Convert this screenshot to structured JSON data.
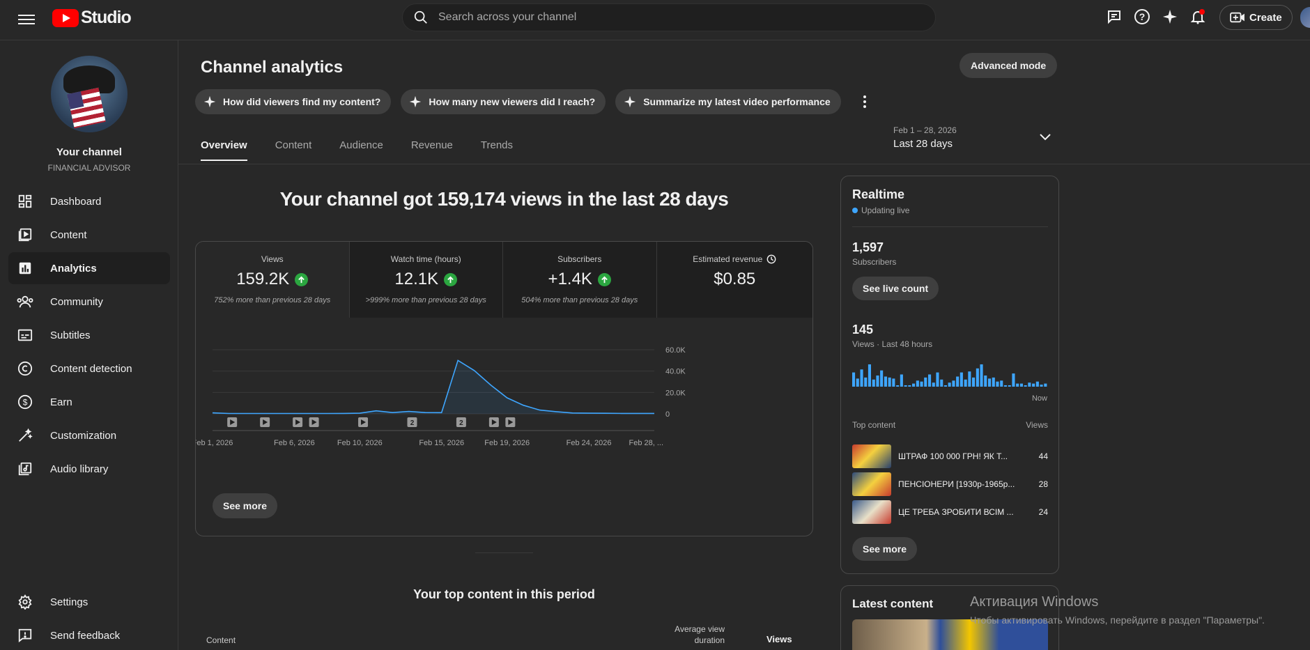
{
  "header": {
    "logo_text": "Studio",
    "search_placeholder": "Search across your channel",
    "create_label": "Create"
  },
  "sidebar": {
    "channel_name": "Your channel",
    "channel_subtitle": "FINANCIAL ADVISOR",
    "items": [
      {
        "label": "Dashboard",
        "icon": "dashboard-icon"
      },
      {
        "label": "Content",
        "icon": "content-icon"
      },
      {
        "label": "Analytics",
        "icon": "analytics-icon",
        "active": true
      },
      {
        "label": "Community",
        "icon": "community-icon"
      },
      {
        "label": "Subtitles",
        "icon": "subtitles-icon"
      },
      {
        "label": "Content detection",
        "icon": "copyright-icon"
      },
      {
        "label": "Earn",
        "icon": "earn-icon"
      },
      {
        "label": "Customization",
        "icon": "customization-icon"
      },
      {
        "label": "Audio library",
        "icon": "audio-library-icon"
      }
    ],
    "bottom": [
      {
        "label": "Settings",
        "icon": "gear-icon"
      },
      {
        "label": "Send feedback",
        "icon": "feedback-icon"
      }
    ]
  },
  "main": {
    "title": "Channel analytics",
    "advanced_mode": "Advanced mode",
    "chips": [
      "How did viewers find my content?",
      "How many new viewers did I reach?",
      "Summarize my latest video performance"
    ],
    "tabs": [
      "Overview",
      "Content",
      "Audience",
      "Revenue",
      "Trends"
    ],
    "date_range": "Feb 1 – 28, 2026",
    "date_label": "Last 28 days",
    "headline": "Your channel got 159,174 views in the last 28 days",
    "metrics": [
      {
        "label": "Views",
        "value": "159.2K",
        "sub": "752% more than previous 28 days"
      },
      {
        "label": "Watch time (hours)",
        "value": "12.1K",
        "sub": ">999% more than previous 28 days"
      },
      {
        "label": "Subscribers",
        "value": "+1.4K",
        "sub": "504% more than previous 28 days"
      },
      {
        "label": "Estimated revenue",
        "value": "$0.85",
        "sub": ""
      }
    ],
    "see_more": "See more",
    "top_content_title": "Your top content in this period",
    "table_headers": {
      "content": "Content",
      "avg_view_duration": "Average view duration",
      "views": "Views"
    }
  },
  "chart_data": {
    "type": "line",
    "title": "",
    "ylim": [
      0,
      60000
    ],
    "y_ticks": [
      "60.0K",
      "40.0K",
      "20.0K",
      "0"
    ],
    "x_tick_labels": [
      "Feb 1, 2026",
      "Feb 6, 2026",
      "Feb 10, 2026",
      "Feb 15, 2026",
      "Feb 19, 2026",
      "Feb 24, 2026",
      "Feb 28, ..."
    ],
    "x_tick_days": [
      1,
      6,
      10,
      15,
      19,
      24,
      27.5
    ],
    "series": [
      {
        "x": [
          1,
          2,
          3,
          4,
          5,
          6,
          7,
          8,
          9,
          10,
          11,
          12,
          13,
          14,
          15,
          16,
          17,
          18,
          19,
          20,
          21,
          22,
          23,
          24,
          25,
          26,
          27,
          28
        ],
        "values": [
          900,
          300,
          300,
          300,
          300,
          300,
          300,
          300,
          400,
          600,
          2800,
          1200,
          2200,
          1200,
          1100,
          50000,
          40500,
          27000,
          15000,
          8000,
          3500,
          2000,
          800,
          600,
          500,
          400,
          400,
          400
        ]
      }
    ],
    "markers": [
      {
        "day": 2.2,
        "kind": "video"
      },
      {
        "day": 4.2,
        "kind": "video"
      },
      {
        "day": 6.2,
        "kind": "video"
      },
      {
        "day": 7.2,
        "kind": "video"
      },
      {
        "day": 10.2,
        "kind": "video"
      },
      {
        "day": 13.2,
        "kind": "count",
        "text": "2"
      },
      {
        "day": 16.2,
        "kind": "count",
        "text": "2"
      },
      {
        "day": 18.2,
        "kind": "video"
      },
      {
        "day": 19.2,
        "kind": "video"
      }
    ]
  },
  "realtime": {
    "title": "Realtime",
    "live": "Updating live",
    "subscribers_value": "1,597",
    "subscribers_label": "Subscribers",
    "live_count_btn": "See live count",
    "views_value": "145",
    "views_label": "Views · Last 48 hours",
    "now_label": "Now",
    "bars": [
      14,
      8,
      17,
      9,
      22,
      7,
      11,
      16,
      10,
      9,
      8,
      0,
      12,
      0,
      0,
      3,
      6,
      5,
      9,
      12,
      4,
      14,
      7,
      0,
      4,
      6,
      10,
      14,
      7,
      15,
      9,
      18,
      22,
      11,
      8,
      9,
      5,
      6,
      0,
      0,
      13,
      3,
      3,
      0,
      4,
      3,
      5,
      2,
      3
    ],
    "top_content_label": "Top content",
    "views_col": "Views",
    "top_items": [
      {
        "title": "ШТРАФ 100 000 ГРН! ЯК Т...",
        "views": "44"
      },
      {
        "title": "ПЕНСІОНЕРИ [1930р-1965р...",
        "views": "28"
      },
      {
        "title": "ЦЕ ТРЕБА ЗРОБИТИ ВСІМ ...",
        "views": "24"
      }
    ],
    "see_more": "See more"
  },
  "latest": {
    "title": "Latest content"
  },
  "watermark": {
    "line1": "Активация Windows",
    "line2": "Чтобы активировать Windows, перейдите в раздел \"Параметры\"."
  },
  "colors": {
    "accent": "#3ea6ff",
    "up": "#2ba640",
    "youtube_red": "#ff0000"
  }
}
